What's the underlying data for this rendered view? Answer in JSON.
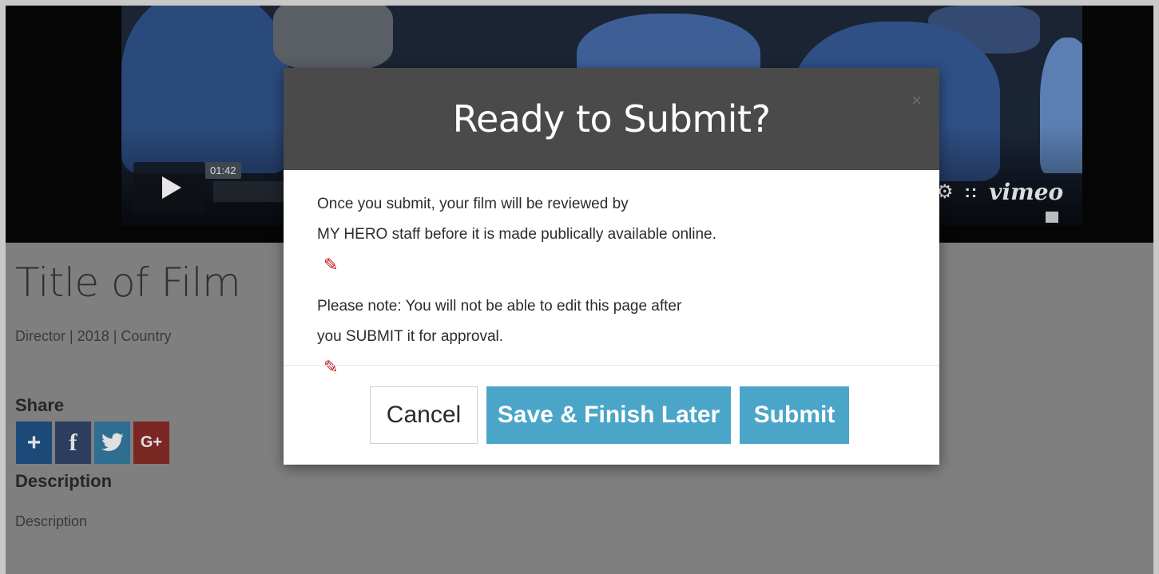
{
  "video": {
    "timecode": "01:42",
    "brand": "vimeo",
    "settings_glyph": "⚙",
    "dots_glyph": "::"
  },
  "film": {
    "title": "Title of Film",
    "meta": "Director | 2018 | Country"
  },
  "share": {
    "title": "Share",
    "buttons": [
      {
        "icon": "plus-icon",
        "glyph": "+",
        "color": "#1b4a78"
      },
      {
        "icon": "facebook-icon",
        "glyph": "f",
        "color": "#2c3d5e"
      },
      {
        "icon": "twitter-icon",
        "glyph": "🐦",
        "color": "#2e6f91"
      },
      {
        "icon": "google-plus-icon",
        "glyph": "G+",
        "color": "#7a2622"
      }
    ]
  },
  "description": {
    "title": "Description",
    "text": "Description"
  },
  "modal": {
    "title": "Ready to Submit?",
    "close_glyph": "×",
    "paragraph1_line1": "Once you submit, your film will be reviewed by",
    "paragraph1_line2": "MY HERO staff before it is made publically available online.",
    "paragraph2_line1": "Please note: You will not be able to edit this page after",
    "paragraph2_line2": "you SUBMIT it for approval.",
    "pencil_glyph": "✎",
    "buttons": {
      "cancel": "Cancel",
      "save_later": "Save & Finish Later",
      "submit": "Submit"
    },
    "colors": {
      "header_bg": "#4a4a4a",
      "primary_button": "#4aa5c9",
      "pencil": "#c8141c"
    }
  }
}
